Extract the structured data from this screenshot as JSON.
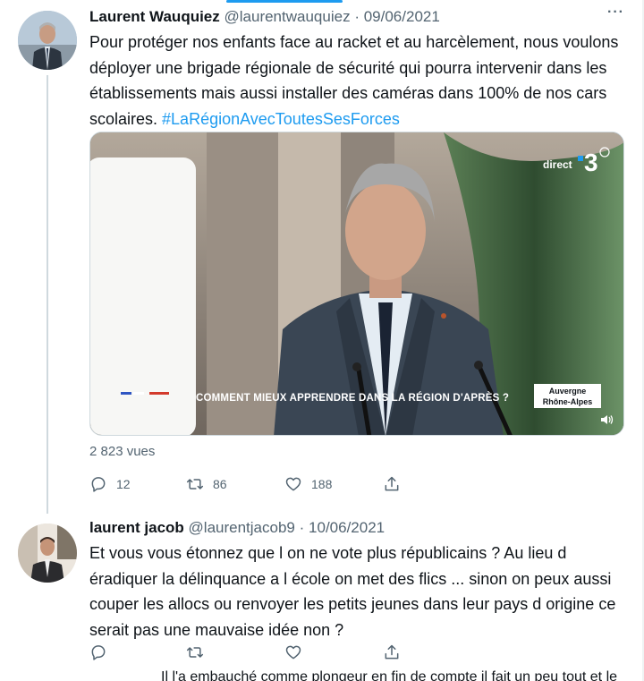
{
  "tweets": [
    {
      "author": "Laurent Wauquiez",
      "handle": "@laurentwauquiez",
      "separator": "·",
      "date": "09/06/2021",
      "more_label": "···",
      "text": "Pour protéger nos enfants face au racket et au harcèlement, nous voulons déployer une brigade régionale de sécurité qui pourra intervenir dans les établissements mais aussi installer des caméras dans 100% de nos cars scolaires. ",
      "hashtag": "#LaRégionAvecToutesSesForces",
      "media": {
        "channel_text": "direct",
        "channel_number": "3",
        "caption": "COMMENT MIEUX APPRENDRE DANS LA RÉGION D'APRÈS ?",
        "region_line1": "Auvergne",
        "region_line2": "Rhône-Alpes"
      },
      "views": "2 823 vues",
      "replies": "12",
      "retweets": "86",
      "likes": "188"
    },
    {
      "author": "laurent jacob",
      "handle": "@laurentjacob9",
      "separator": "·",
      "date": "10/06/2021",
      "text": "Et vous vous étonnez que l on ne vote plus républicains ? Au lieu d éradiquer la délinquance a l école on met des flics ... sinon on peux aussi couper les allocs ou renvoyer les petits jeunes dans leur pays d origine ce serait pas une mauvaise idée non ?",
      "replies": "",
      "retweets": "",
      "likes": ""
    }
  ],
  "clipped_next_text": "Il l'a embauché comme plongeur en fin de compte il fait un peu tout et le",
  "colors": {
    "accent": "#1d9bf0",
    "text": "#0f1419",
    "secondary": "#536471",
    "divider": "#cfd9de"
  },
  "icons": [
    "reply-icon",
    "retweet-icon",
    "like-icon",
    "share-icon",
    "sound-icon",
    "more-icon"
  ]
}
